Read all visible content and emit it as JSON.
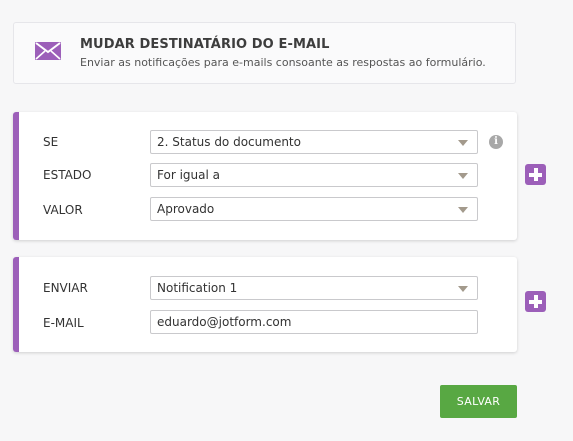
{
  "header": {
    "icon": "envelope-icon",
    "title": "MUDAR DESTINATÁRIO DO E-MAIL",
    "subtitle": "Enviar as notificações para e-mails consoante as respostas ao formulário."
  },
  "condition": {
    "if_label": "SE",
    "if_value": "2. Status do documento",
    "state_label": "ESTADO",
    "state_value": "For igual a",
    "value_label": "VALOR",
    "value_value": "Aprovado",
    "info_glyph": "i"
  },
  "action": {
    "send_label": "ENVIAR",
    "send_value": "Notification 1",
    "email_label": "E-MAIL",
    "email_value": "eduardo@jotform.com"
  },
  "buttons": {
    "add_condition_icon": "plus-icon",
    "add_action_icon": "plus-icon",
    "save_label": "SALVAR"
  },
  "colors": {
    "accent": "#9c5fb9",
    "save": "#58a843"
  }
}
